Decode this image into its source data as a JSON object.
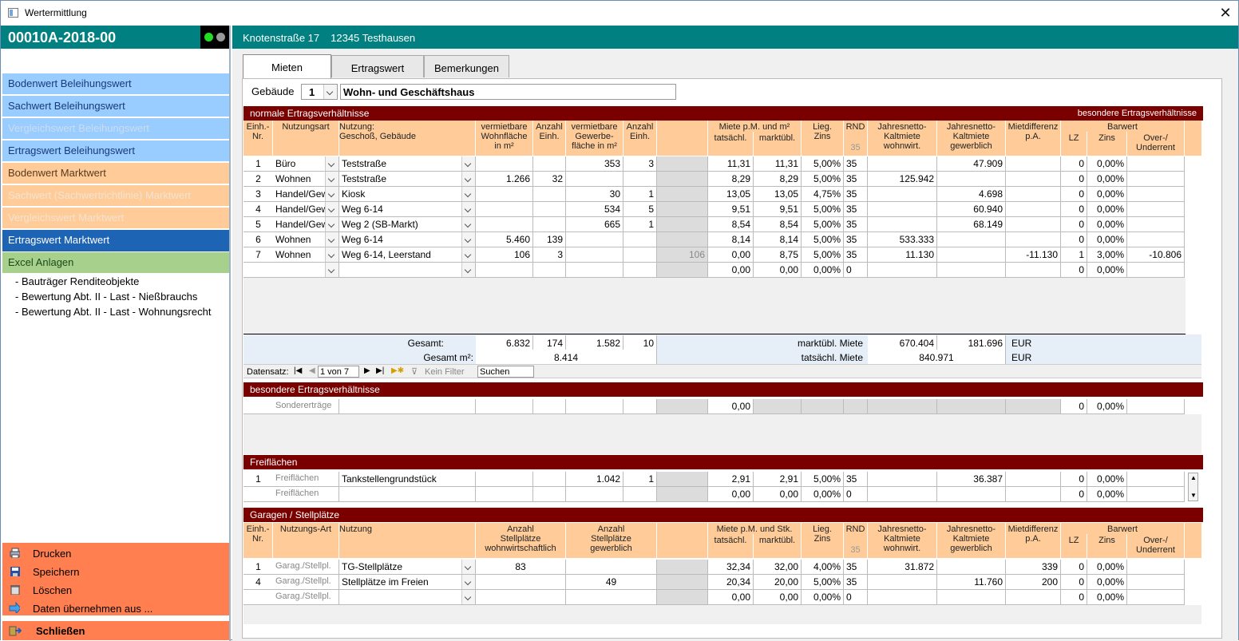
{
  "window": {
    "title": "Wertermittlung",
    "close": "✕"
  },
  "case": {
    "id": "00010A-2018-00"
  },
  "address": {
    "street": "Knotenstraße 17",
    "city": "12345 Testhausen"
  },
  "nav": [
    {
      "label": "Bodenwert Beleihungswert",
      "style": "blue"
    },
    {
      "label": "Sachwert Beleihungswert",
      "style": "blue"
    },
    {
      "label": "Vergleichswert Beleihungswert",
      "style": "blue dis"
    },
    {
      "label": "Ertragswert Beleihungswert",
      "style": "blue"
    },
    {
      "label": "Bodenwert Marktwert",
      "style": "or"
    },
    {
      "label": "Sachwert (Sachwertrichtlinie) Marktwert",
      "style": "or dis"
    },
    {
      "label": "Vergleichswert Marktwert",
      "style": "or dis"
    },
    {
      "label": "Ertragswert Marktwert",
      "style": "dark"
    },
    {
      "label": "Excel Anlagen",
      "style": "green"
    }
  ],
  "subitems": [
    "- Bauträger Renditeobjekte",
    "- Bewertung Abt. II - Last - Nießbrauchs",
    "- Bewertung Abt. II - Last - Wohnungsrecht"
  ],
  "actions": [
    {
      "label": "Drucken",
      "icon": "printer-icon"
    },
    {
      "label": "Speichern",
      "icon": "floppy-icon"
    },
    {
      "label": "Löschen",
      "icon": "trash-icon"
    },
    {
      "label": "Daten übernehmen aus ...",
      "icon": "arrow-right-icon"
    }
  ],
  "close_label": "Schließen",
  "tabs": [
    "Mieten",
    "Ertragswert",
    "Bemerkungen"
  ],
  "building": {
    "label": "Gebäude",
    "num": "1",
    "name": "Wohn- und Geschäftshaus"
  },
  "sec1": {
    "title": "normale Ertragsverhältnisse",
    "right": "besondere Ertragsverhältnisse"
  },
  "headers": {
    "nr": "Einh.-\nNr.",
    "nutzungsart": "Nutzungsart",
    "nutzung": "Nutzung:\nGeschoß, Gebäude",
    "wohn": "vermietbare\nWohnfläche\nin m²",
    "anzw": "Anzahl\nEinh.",
    "gew": "vermietbare\nGewerbe-\nfläche in m²",
    "anzg": "Anzahl\nEinh.",
    "miete": "Miete p.M. und m²",
    "tats": "tatsächl.",
    "markt": "marktübl.",
    "zins": "Lieg.\nZins",
    "rnd": "RND",
    "rnd2": "35",
    "jw": "Jahresnetto-\nKaltmiete\nwohnwirt.",
    "jg": "Jahresnetto-\nKaltmiete\ngewerblich",
    "md": "Mietdifferenz\np.A.",
    "bw": "Barwert",
    "lz": "LZ",
    "bzins": "Zins",
    "ou": "Over-/\nUnderrent"
  },
  "rows": [
    {
      "nr": "1",
      "art": "Büro",
      "nutz": "Teststraße",
      "wf": "",
      "aw": "",
      "gf": "353",
      "ag": "3",
      "x": "",
      "t": "11,31",
      "m": "11,31",
      "z": "5,00%",
      "rnd": "35",
      "jw": "",
      "jg": "47.909",
      "md": "",
      "lz": "0",
      "bz": "0,00%",
      "ou": ""
    },
    {
      "nr": "2",
      "art": "Wohnen",
      "nutz": "Teststraße",
      "wf": "1.266",
      "aw": "32",
      "gf": "",
      "ag": "",
      "x": "",
      "t": "8,29",
      "m": "8,29",
      "z": "5,00%",
      "rnd": "35",
      "jw": "125.942",
      "jg": "",
      "md": "",
      "lz": "0",
      "bz": "0,00%",
      "ou": ""
    },
    {
      "nr": "3",
      "art": "Handel/Gewe",
      "nutz": "Kiosk",
      "wf": "",
      "aw": "",
      "gf": "30",
      "ag": "1",
      "x": "",
      "t": "13,05",
      "m": "13,05",
      "z": "4,75%",
      "rnd": "35",
      "jw": "",
      "jg": "4.698",
      "md": "",
      "lz": "0",
      "bz": "0,00%",
      "ou": ""
    },
    {
      "nr": "4",
      "art": "Handel/Gewe",
      "nutz": "Weg 6-14",
      "wf": "",
      "aw": "",
      "gf": "534",
      "ag": "5",
      "x": "",
      "t": "9,51",
      "m": "9,51",
      "z": "5,00%",
      "rnd": "35",
      "jw": "",
      "jg": "60.940",
      "md": "",
      "lz": "0",
      "bz": "0,00%",
      "ou": ""
    },
    {
      "nr": "5",
      "art": "Handel/Gewe",
      "nutz": "Weg 2 (SB-Markt)",
      "wf": "",
      "aw": "",
      "gf": "665",
      "ag": "1",
      "x": "",
      "t": "8,54",
      "m": "8,54",
      "z": "5,00%",
      "rnd": "35",
      "jw": "",
      "jg": "68.149",
      "md": "",
      "lz": "0",
      "bz": "0,00%",
      "ou": ""
    },
    {
      "nr": "6",
      "art": "Wohnen",
      "nutz": "Weg 6-14",
      "wf": "5.460",
      "aw": "139",
      "gf": "",
      "ag": "",
      "x": "",
      "t": "8,14",
      "m": "8,14",
      "z": "5,00%",
      "rnd": "35",
      "jw": "533.333",
      "jg": "",
      "md": "",
      "lz": "0",
      "bz": "0,00%",
      "ou": ""
    },
    {
      "nr": "7",
      "art": "Wohnen",
      "nutz": "Weg 6-14, Leerstand",
      "wf": "106",
      "aw": "3",
      "gf": "",
      "ag": "",
      "x": "106",
      "t": "0,00",
      "m": "8,75",
      "z": "5,00%",
      "rnd": "35",
      "jw": "11.130",
      "jg": "",
      "md": "-11.130",
      "lz": "1",
      "bz": "3,00%",
      "ou": "-10.806"
    },
    {
      "nr": "",
      "art": "",
      "nutz": "",
      "wf": "",
      "aw": "",
      "gf": "",
      "ag": "",
      "x": "",
      "t": "0,00",
      "m": "0,00",
      "z": "0,00%",
      "rnd": "0",
      "jw": "",
      "jg": "",
      "md": "",
      "lz": "0",
      "bz": "0,00%",
      "ou": ""
    }
  ],
  "totals": {
    "gesamt": "Gesamt:",
    "wf": "6.832",
    "aw": "174",
    "gf": "1.582",
    "ag": "10",
    "gesamtm2": "Gesamt m²:",
    "m2": "8.414",
    "marktl": "marktübl. Miete",
    "jw": "670.404",
    "jg": "181.696",
    "eur1": "EUR",
    "tatsl": "tatsächl. Miete",
    "tatsv": "840.971",
    "eur2": "EUR"
  },
  "recnav": {
    "label": "Datensatz:",
    "pos": "1 von 7",
    "filter": "Kein Filter",
    "search": "Suchen"
  },
  "sec2": {
    "title": "besondere Ertragsverhältnisse",
    "art": "Sondererträge",
    "t": "0,00",
    "lz": "0",
    "bz": "0,00%"
  },
  "sec3": {
    "title": "Freiflächen",
    "rows": [
      {
        "nr": "1",
        "art": "Freiflächen",
        "nutz": "Tankstellengrundstück",
        "gf": "1.042",
        "ag": "1",
        "t": "2,91",
        "m": "2,91",
        "z": "5,00%",
        "rnd": "35",
        "jg": "36.387",
        "lz": "0",
        "bz": "0,00%"
      },
      {
        "nr": "",
        "art": "Freiflächen",
        "nutz": "",
        "gf": "",
        "ag": "",
        "t": "0,00",
        "m": "0,00",
        "z": "0,00%",
        "rnd": "0",
        "jg": "",
        "lz": "0",
        "bz": "0,00%"
      }
    ]
  },
  "sec4": {
    "title": "Garagen / Stellplätze",
    "headers": {
      "nr": "Einh.-\nNr.",
      "art": "Nutzungs-Art",
      "nutz": "Nutzung",
      "sw": "Anzahl\nStellplätze\nwohnwirtschaftlich",
      "sg": "Anzahl\nStellplätze\ngewerblich",
      "miete": "Miete p.M. und Stk.",
      "tats": "tatsächl.",
      "markt": "marktübl."
    },
    "rows": [
      {
        "nr": "1",
        "art": "Garag./Stellpl.",
        "nutz": "TG-Stellplätze",
        "sw": "83",
        "sg": "",
        "t": "32,34",
        "m": "32,00",
        "z": "4,00%",
        "rnd": "35",
        "jw": "31.872",
        "jg": "",
        "md": "339",
        "lz": "0",
        "bz": "0,00%"
      },
      {
        "nr": "4",
        "art": "Garag./Stellpl.",
        "nutz": "Stellplätze im Freien",
        "sw": "",
        "sg": "49",
        "t": "20,34",
        "m": "20,00",
        "z": "5,00%",
        "rnd": "35",
        "jw": "",
        "jg": "11.760",
        "md": "200",
        "lz": "0",
        "bz": "0,00%"
      },
      {
        "nr": "",
        "art": "Garag./Stellpl.",
        "nutz": "",
        "sw": "",
        "sg": "",
        "t": "0,00",
        "m": "0,00",
        "z": "0,00%",
        "rnd": "0",
        "jw": "",
        "jg": "",
        "md": "",
        "lz": "0",
        "bz": "0,00%"
      }
    ]
  }
}
